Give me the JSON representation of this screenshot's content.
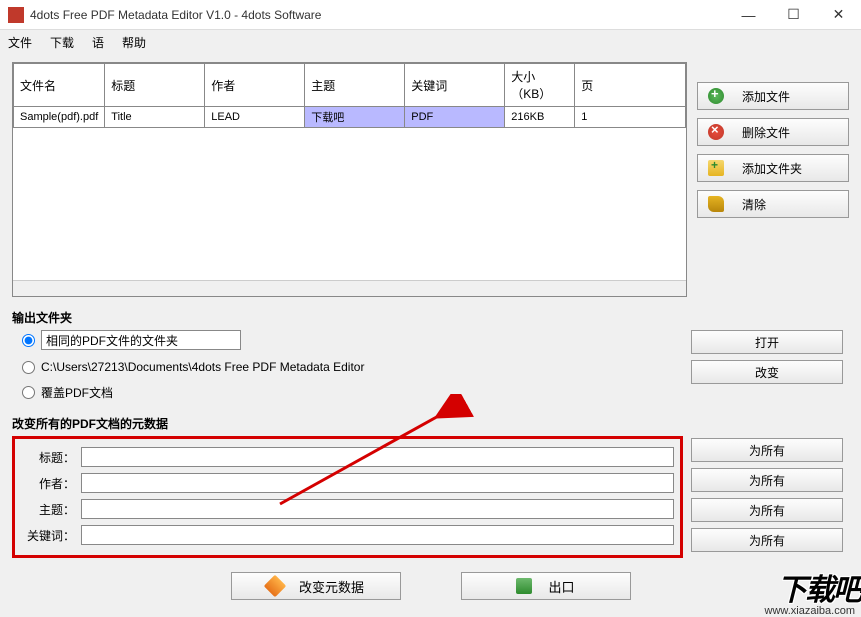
{
  "window": {
    "title": "4dots Free PDF Metadata Editor V1.0 - 4dots Software"
  },
  "menu": {
    "file": "文件",
    "download": "下载",
    "language": "语",
    "help": "帮助"
  },
  "table": {
    "headers": {
      "filename": "文件名",
      "title": "标题",
      "author": "作者",
      "subject": "主题",
      "keywords": "关键词",
      "size": "大小（KB）",
      "pages": "页"
    },
    "rows": [
      {
        "filename": "Sample(pdf).pdf",
        "title": "Title",
        "author": "LEAD",
        "subject": "下载吧",
        "keywords": "PDF",
        "size": "216KB",
        "pages": "1"
      }
    ]
  },
  "side": {
    "addFile": "添加文件",
    "deleteFile": "删除文件",
    "addFolder": "添加文件夹",
    "clear": "清除"
  },
  "output": {
    "group": "输出文件夹",
    "same": "相同的PDF文件的文件夹",
    "path": "C:\\Users\\27213\\Documents\\4dots Free PDF Metadata Editor",
    "overwrite": "覆盖PDF文档",
    "open": "打开",
    "change": "改变"
  },
  "meta": {
    "group": "改变所有的PDF文档的元数据",
    "titleLabel": "标题：",
    "authorLabel": "作者：",
    "subjectLabel": "主题：",
    "keywordsLabel": "关键词：",
    "forAll": "为所有"
  },
  "bottom": {
    "changeMeta": "改变元数据",
    "export": "出口"
  },
  "watermark": {
    "big": "下载吧",
    "url": "www.xiazaiba.com"
  }
}
